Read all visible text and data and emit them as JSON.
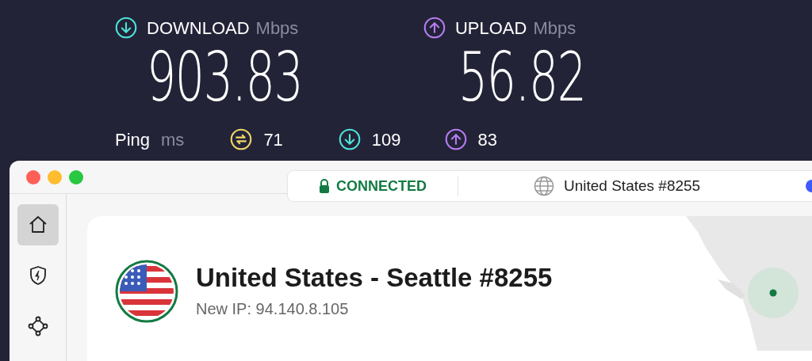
{
  "speed": {
    "download": {
      "label": "DOWNLOAD",
      "unit": "Mbps",
      "value": "903.83"
    },
    "upload": {
      "label": "UPLOAD",
      "unit": "Mbps",
      "value": "56.82"
    },
    "ping": {
      "label": "Ping",
      "unit": "ms",
      "items": [
        {
          "kind": "jitter",
          "value": "71"
        },
        {
          "kind": "down",
          "value": "109"
        },
        {
          "kind": "up",
          "value": "83"
        }
      ]
    }
  },
  "window": {
    "status": "CONNECTED",
    "server": "United States #8255"
  },
  "sidebar": {
    "items": [
      {
        "kind": "home",
        "selected": true
      },
      {
        "kind": "shield",
        "selected": false
      },
      {
        "kind": "nodes",
        "selected": false
      }
    ]
  },
  "connection": {
    "title": "United States - Seattle #8255",
    "ip": "New IP: 94.140.8.105"
  }
}
